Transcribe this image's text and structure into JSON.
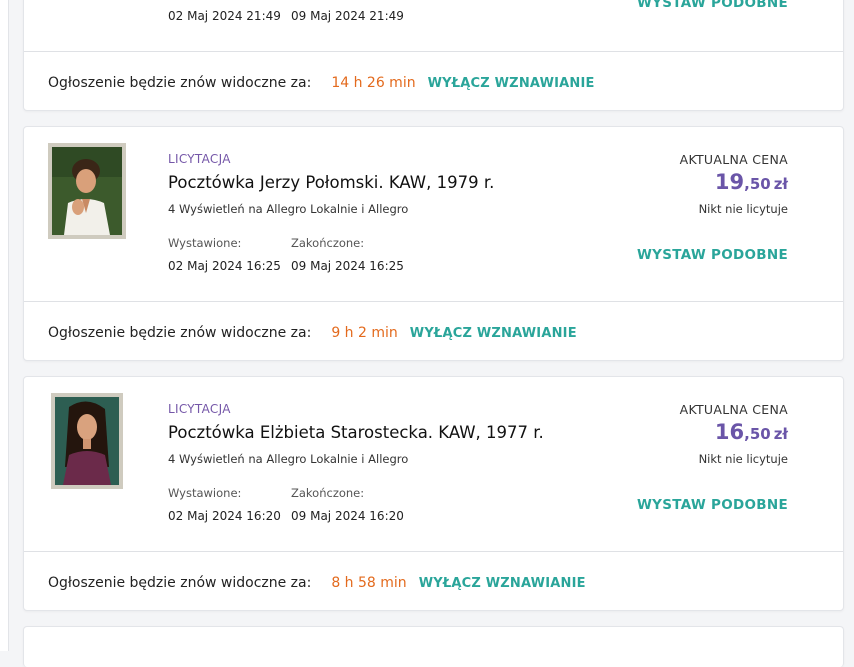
{
  "listings": [
    {
      "type": "",
      "title": "",
      "views": "",
      "listed_label": "",
      "listed_date": "02 Maj 2024 21:49",
      "ended_label": "",
      "ended_date": "09 Maj 2024 21:49",
      "price_label": "",
      "price_int": "",
      "price_dec": "",
      "currency": "",
      "bid_status": "",
      "similar_button": "WYSTAW PODOBNE",
      "renew_text": "Ogłoszenie będzie znów widoczne za:",
      "renew_time": "14 h 26 min",
      "renew_toggle": "WYŁĄCZ WZNAWIANIE"
    },
    {
      "type": "LICYTACJA",
      "title": "Pocztówka Jerzy Połomski. KAW, 1979 r.",
      "views": "4 Wyświetleń na Allegro Lokalnie i Allegro",
      "listed_label": "Wystawione:",
      "listed_date": "02 Maj 2024 16:25",
      "ended_label": "Zakończone:",
      "ended_date": "09 Maj 2024 16:25",
      "price_label": "AKTUALNA CENA",
      "price_int": "19",
      "price_dec": ",50",
      "currency": "zł",
      "bid_status": "Nikt nie licytuje",
      "similar_button": "WYSTAW PODOBNE",
      "renew_text": "Ogłoszenie będzie znów widoczne za:",
      "renew_time": "9 h 2 min",
      "renew_toggle": "WYŁĄCZ WZNAWIANIE",
      "thumbnail_icon": "postcard-photo-man"
    },
    {
      "type": "LICYTACJA",
      "title": "Pocztówka Elżbieta Starostecka. KAW, 1977 r.",
      "views": "4 Wyświetleń na Allegro Lokalnie i Allegro",
      "listed_label": "Wystawione:",
      "listed_date": "02 Maj 2024 16:20",
      "ended_label": "Zakończone:",
      "ended_date": "09 Maj 2024 16:20",
      "price_label": "AKTUALNA CENA",
      "price_int": "16",
      "price_dec": ",50",
      "currency": "zł",
      "bid_status": "Nikt nie licytuje",
      "similar_button": "WYSTAW PODOBNE",
      "renew_text": "Ogłoszenie będzie znów widoczne za:",
      "renew_time": "8 h 58 min",
      "renew_toggle": "WYŁĄCZ WZNAWIANIE",
      "thumbnail_icon": "postcard-photo-woman"
    }
  ],
  "colors": {
    "accent_teal": "#2aa59a",
    "type_purple": "#7557a8",
    "price_purple": "#6a55a8",
    "timer_orange": "#e36a1d"
  }
}
